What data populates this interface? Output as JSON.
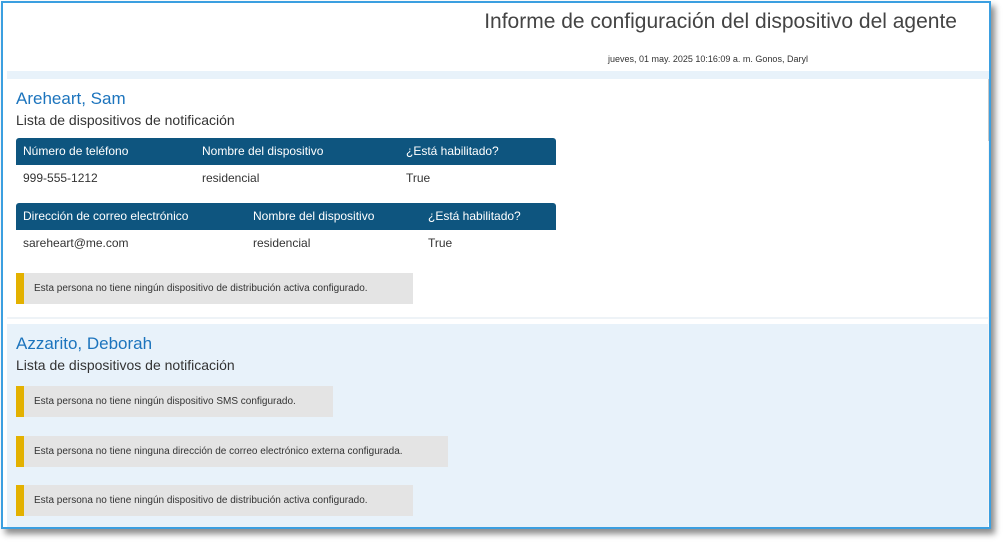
{
  "header": {
    "title": "Informe de configuración del dispositivo del agente",
    "meta": "jueves, 01 may. 2025 10:16:09 a. m. Gonos, Daryl"
  },
  "people": [
    {
      "name": "Areheart, Sam",
      "section": "Lista de dispositivos de notificación",
      "phone_table": {
        "headers": [
          "Número de teléfono",
          "Nombre del dispositivo",
          "¿Está habilitado?"
        ],
        "row": [
          "999-555-1212",
          "residencial",
          "True"
        ]
      },
      "email_table": {
        "headers": [
          "Dirección de correo electrónico",
          "Nombre del dispositivo",
          "¿Está habilitado?"
        ],
        "row": [
          "sareheart@me.com",
          "residencial",
          "True"
        ]
      },
      "notices": [
        "Esta persona no tiene ningún dispositivo de distribución activa configurado."
      ]
    },
    {
      "name": "Azzarito, Deborah",
      "section": "Lista de dispositivos de notificación",
      "notices": [
        "Esta persona no tiene ningún dispositivo SMS configurado.",
        "Esta persona no tiene ninguna dirección de correo electrónico externa configurada.",
        "Esta persona no tiene ningún dispositivo de distribución activa configurado."
      ]
    }
  ],
  "colors": {
    "frame_border": "#3b9fe0",
    "table_header": "#0e557f",
    "name_link": "#1c74bd",
    "notice_accent": "#e3b100",
    "notice_bg": "#e4e4e4",
    "alt_section_bg": "#e8f2fa"
  }
}
